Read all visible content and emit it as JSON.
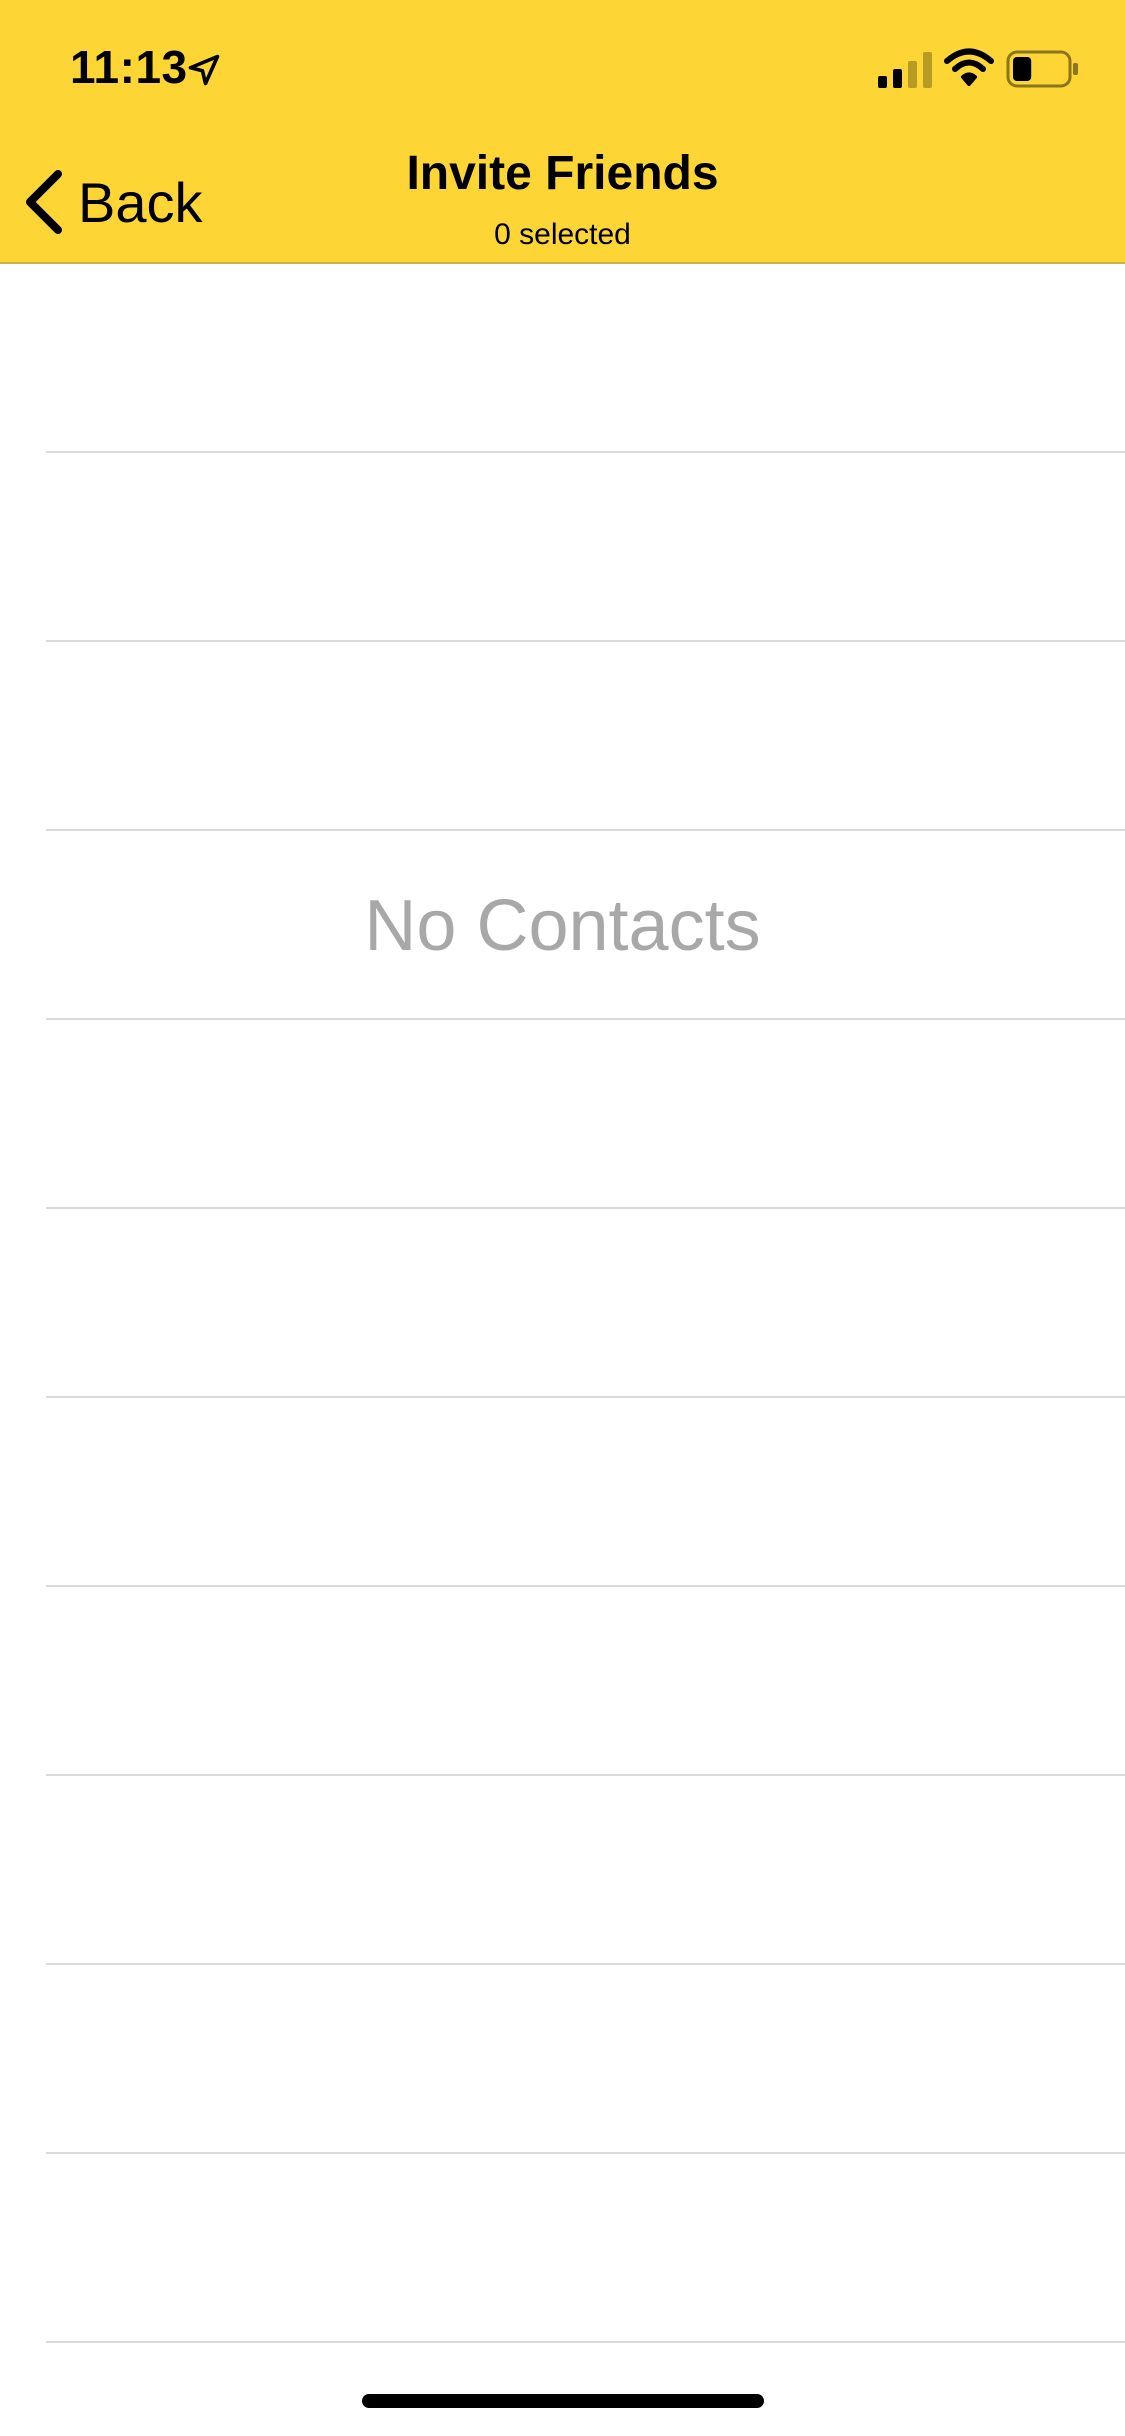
{
  "status_bar": {
    "time": "11:13",
    "location_icon": "location-arrow-icon",
    "signal_icon": "cellular-signal-icon",
    "wifi_icon": "wifi-icon",
    "battery_icon": "battery-icon",
    "battery_level": 0.35
  },
  "nav": {
    "back_label": "Back",
    "back_icon": "chevron-left-icon",
    "title": "Invite Friends",
    "subtitle": "0 selected",
    "background_color": "#FDD535"
  },
  "contacts": {
    "empty_text": "No Contacts",
    "row_count": 11
  }
}
